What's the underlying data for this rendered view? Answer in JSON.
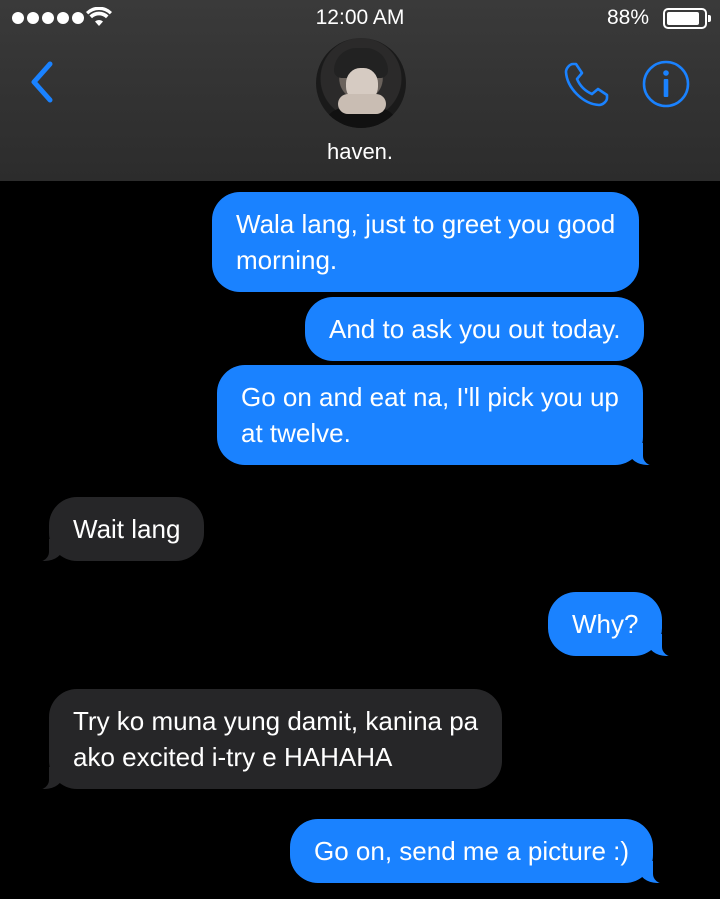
{
  "status_bar": {
    "time": "12:00 AM",
    "battery_percent": "88%",
    "signal_bars": 5,
    "battery_level": 0.88
  },
  "contact": {
    "name": "haven."
  },
  "icons": {
    "back": "chevron-left-icon",
    "call": "phone-icon",
    "info": "info-icon"
  },
  "colors": {
    "accent": "#1a82ff",
    "incoming_bubble": "#262628",
    "background": "#000000"
  },
  "messages": [
    {
      "direction": "outgoing",
      "lines": [
        "Wala lang, just to greet you good",
        "morning."
      ]
    },
    {
      "direction": "outgoing",
      "lines": [
        "And to ask you out today."
      ]
    },
    {
      "direction": "outgoing",
      "lines": [
        "Go on and eat na, I'll pick you up",
        "at twelve."
      ]
    },
    {
      "direction": "incoming",
      "lines": [
        "Wait lang"
      ]
    },
    {
      "direction": "outgoing",
      "lines": [
        "Why?"
      ]
    },
    {
      "direction": "incoming",
      "lines": [
        "Try ko muna yung damit, kanina pa",
        "ako excited i-try e HAHAHA"
      ]
    },
    {
      "direction": "outgoing",
      "lines": [
        "Go on, send me a picture :)"
      ]
    }
  ]
}
